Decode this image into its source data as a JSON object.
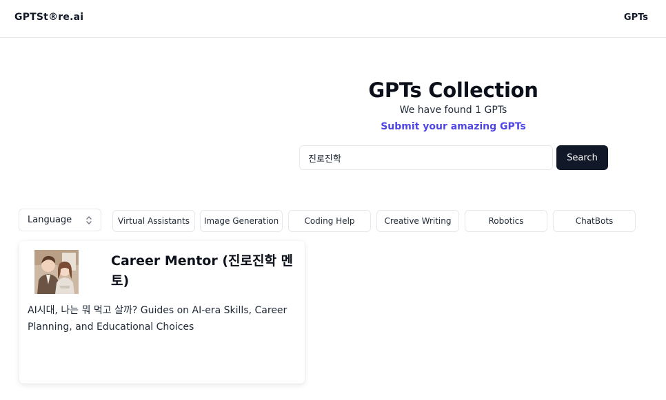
{
  "header": {
    "logo": "GPTSt®re.ai",
    "nav_gpts": "GPTs"
  },
  "hero": {
    "title": "GPTs Collection",
    "found_text": "We have found 1 GPTs",
    "submit_link": "Submit your amazing GPTs"
  },
  "search": {
    "value": "진로진학",
    "button_label": "Search"
  },
  "filters": {
    "language_label": "Language",
    "tags": [
      "Virtual Assistants",
      "Image Generation",
      "Coding Help",
      "Creative Writing",
      "Robotics",
      "ChatBots"
    ]
  },
  "results": [
    {
      "title": "Career Mentor (진로진학 멘토)",
      "description": "AI시대, 나는 뭐 먹고 살까? Guides on AI-era Skills, Career Planning, and Educational Choices"
    }
  ],
  "icons": {
    "language_select": "chevron-updown-icon"
  },
  "colors": {
    "accent": "#4f46e5",
    "button_bg": "#111827",
    "border": "#e5e7eb"
  }
}
